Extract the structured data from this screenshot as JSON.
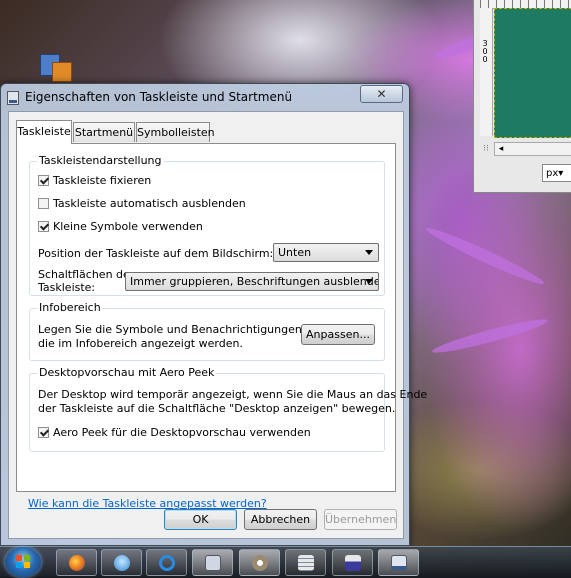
{
  "dialog": {
    "title": "Eigenschaften von Taskleiste und Startmenü",
    "close_symbol": "✕",
    "tabs": [
      {
        "label": "Taskleiste",
        "active": true
      },
      {
        "label": "Startmenü",
        "active": false
      },
      {
        "label": "Symbolleisten",
        "active": false
      }
    ],
    "taskbar_appearance": {
      "title": "Taskleistendarstellung",
      "lock_taskbar": {
        "label": "Taskleiste fixieren",
        "checked": true
      },
      "auto_hide": {
        "label": "Taskleiste automatisch ausblenden",
        "checked": false
      },
      "small_icons": {
        "label": "Kleine Symbole verwenden",
        "checked": true
      },
      "position_label": "Position der Taskleiste auf dem Bildschirm:",
      "position_value": "Unten",
      "buttons_label_line1": "Schaltflächen der",
      "buttons_label_line2": "Taskleiste:",
      "buttons_value": "Immer gruppieren, Beschriftungen ausblenden"
    },
    "notification_area": {
      "title": "Infobereich",
      "text_line1": "Legen Sie die Symbole und Benachrichtigungen fest,",
      "text_line2": "die im Infobereich angezeigt werden.",
      "customize_label": "Anpassen..."
    },
    "aero_peek": {
      "title": "Desktopvorschau mit Aero Peek",
      "text_line1": "Der Desktop wird temporär angezeigt, wenn Sie die Maus an das Ende",
      "text_line2": "der Taskleiste auf die Schaltfläche \"Desktop anzeigen\" bewegen.",
      "use_peek": {
        "label": "Aero Peek für die Desktopvorschau verwenden",
        "checked": true
      }
    },
    "help_link": "Wie kann die Taskleiste angepasst werden?",
    "ok_label": "OK",
    "cancel_label": "Abbrechen",
    "apply_label": "Übernehmen"
  },
  "background_window": {
    "ruler_number": "300",
    "unit_value": "px▾",
    "scroll_left": "◂",
    "corner_icon": "⁝⁝"
  },
  "taskbar": {
    "buttons": [
      {
        "name": "firefox",
        "color": "#e8731c"
      },
      {
        "name": "messenger",
        "color": "#3a8ad6"
      },
      {
        "name": "internet-explorer",
        "color": "#2a8ae0"
      },
      {
        "name": "window",
        "color": "#cfd8e2"
      },
      {
        "name": "gimp",
        "color": "#9a8a70"
      },
      {
        "name": "notepad",
        "color": "#e8e8e8"
      },
      {
        "name": "save-disk",
        "color": "#3a3a9a"
      },
      {
        "name": "taskbar-properties",
        "color": "#dfe6ef"
      }
    ]
  }
}
